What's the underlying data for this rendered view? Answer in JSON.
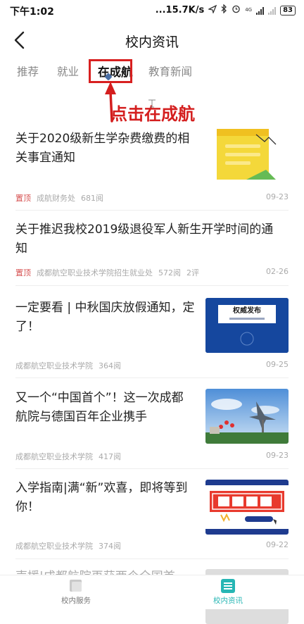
{
  "status_bar": {
    "time": "下午1:02",
    "speed": "...15.7K/s",
    "network": "4G",
    "battery": "83"
  },
  "header": {
    "title": "校内资讯"
  },
  "tabs": [
    {
      "label": "推荐"
    },
    {
      "label": "就业"
    },
    {
      "label": "在成航"
    },
    {
      "label": "教育新闻"
    }
  ],
  "annotation": {
    "text": "点击在成航"
  },
  "thumbs": {
    "holiday_title": "权威发布"
  },
  "feed": [
    {
      "title_lines": [
        "关于2020级新生学杂费缴费的相",
        "关事宜通知"
      ],
      "pinned": "置顶",
      "source": "成航财务处",
      "reads": "681阅",
      "comments": "",
      "date": "09-23"
    },
    {
      "title_lines": [
        "关于推迟我校2019级退役军人新生开学时间的通",
        "知"
      ],
      "pinned": "置顶",
      "source": "成都航空职业技术学院招生就业处",
      "reads": "572阅",
      "comments": "2评",
      "date": "02-26"
    },
    {
      "title_lines": [
        "一定要看 | 中秋国庆放假通知，定",
        "了！"
      ],
      "pinned": "",
      "source": "成都航空职业技术学院",
      "reads": "364阅",
      "comments": "",
      "date": "09-25"
    },
    {
      "title_lines": [
        "又一个“中国首个”！这一次成都",
        "航院与德国百年企业携手"
      ],
      "pinned": "",
      "source": "成都航空职业技术学院",
      "reads": "417阅",
      "comments": "",
      "date": "09-23"
    },
    {
      "title_lines": [
        "入学指南|满“新”欢喜，即将等到",
        "你！"
      ],
      "pinned": "",
      "source": "成都航空职业技术学院",
      "reads": "374阅",
      "comments": "",
      "date": "09-22"
    },
    {
      "title_lines": [
        "声援|成都航院再获两个全国首"
      ],
      "pinned": "",
      "source": "",
      "reads": "",
      "comments": "",
      "date": ""
    }
  ],
  "bottom_nav": [
    {
      "label": "校内服务",
      "icon": "service-icon"
    },
    {
      "label": "校内资讯",
      "icon": "news-icon"
    }
  ],
  "colors": {
    "accent": "#26b6b4",
    "annotation_red": "#d41e1e"
  }
}
